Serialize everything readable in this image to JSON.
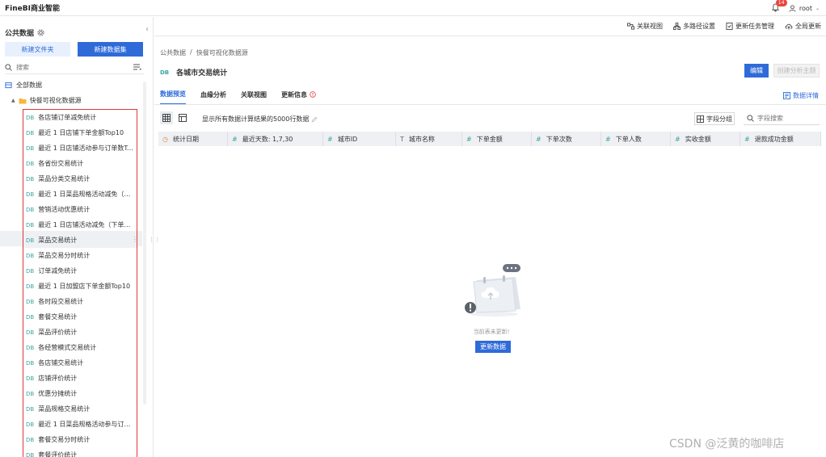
{
  "app": {
    "brand": "FineBI商业智能"
  },
  "topbar": {
    "notification_count": "14",
    "user_name": "root"
  },
  "sidebar": {
    "title": "公共数据",
    "new_folder_label": "新建文件夹",
    "new_dataset_label": "新建数据集",
    "search_placeholder": "搜索",
    "root_label": "全部数据",
    "folder_label": "快餐可视化数据源",
    "items": [
      "各店铺订单减免统计",
      "最近 1 日店铺下单金额Top10",
      "最近 1 日店铺活动参与订单数Top10",
      "各省份交易统计",
      "菜品分类交易统计",
      "最近 1 日菜品规格活动减免（下单...",
      "营销活动优惠统计",
      "最近 1 日店铺活动减免（下单）金...",
      "菜品交易统计",
      "菜品交易分时统计",
      "订单减免统计",
      "最近 1 日加盟店下单金额Top10",
      "各时段交易统计",
      "套餐交易统计",
      "菜品评价统计",
      "各经营模式交易统计",
      "各店铺交易统计",
      "店铺评价统计",
      "优惠分摊统计",
      "菜品规格交易统计",
      "最近 1 日菜品规格活动参与订单数T...",
      "套餐交易分时统计",
      "套餐评价统计"
    ],
    "db_tag": "DB"
  },
  "toolbar": {
    "items": [
      "关联视图",
      "多路径设置",
      "更新任务管理",
      "全局更新"
    ]
  },
  "main": {
    "breadcrumb": [
      "公共数据",
      "/",
      "快餐可视化数据源"
    ],
    "title": "各城市交易统计",
    "edit_label": "编辑",
    "create_label": "创建分析主题",
    "tabs": [
      "数据预览",
      "血缘分析",
      "关联视图",
      "更新信息"
    ],
    "data_detail_label": "数据详情",
    "row_hint": "显示所有数据计算结果的5000行数据",
    "group_label": "字段分组",
    "field_search_placeholder": "字段搜索",
    "columns": [
      {
        "name": "统计日期",
        "type": "date"
      },
      {
        "name": "最近天数: 1,7,30",
        "type": "number"
      },
      {
        "name": "城市ID",
        "type": "number"
      },
      {
        "name": "城市名称",
        "type": "text"
      },
      {
        "name": "下单金额",
        "type": "number"
      },
      {
        "name": "下单次数",
        "type": "number"
      },
      {
        "name": "下单人数",
        "type": "number"
      },
      {
        "name": "实收金额",
        "type": "number"
      },
      {
        "name": "退款成功金额",
        "type": "number"
      }
    ],
    "empty_text": "当前表未更新!",
    "refresh_label": "更新数据"
  },
  "watermark": "CSDN @泛黄的咖啡店"
}
